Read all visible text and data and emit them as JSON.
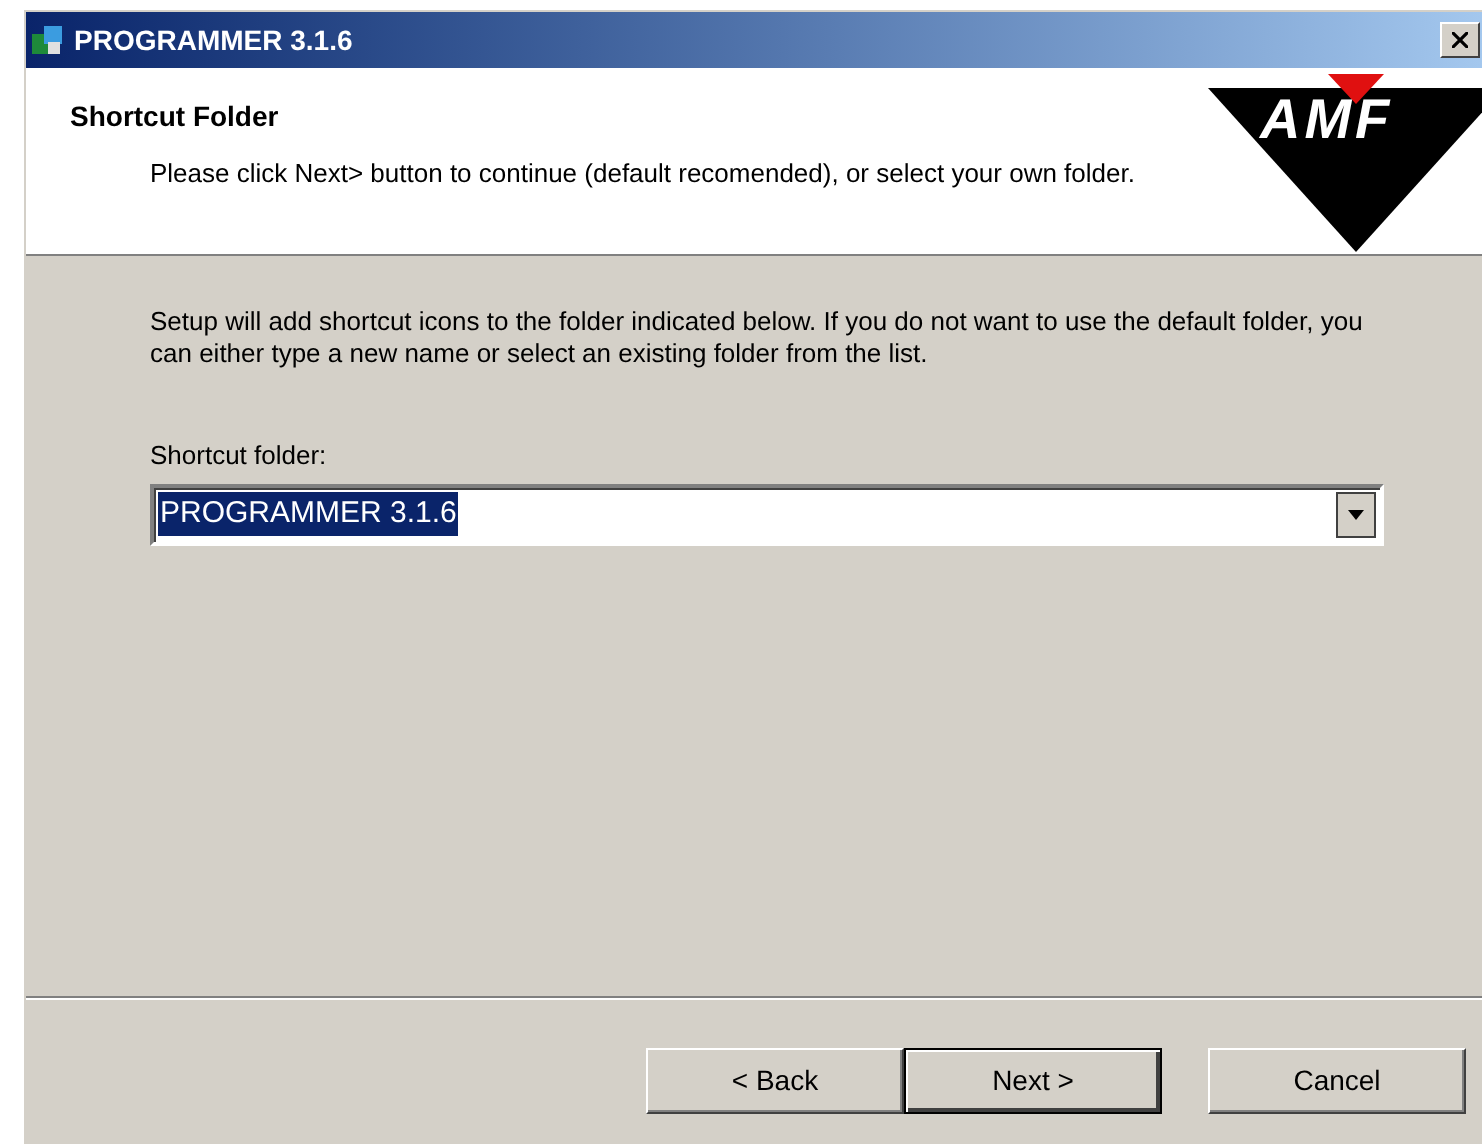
{
  "window": {
    "title": "PROGRAMMER 3.1.6"
  },
  "header": {
    "title": "Shortcut Folder",
    "subtitle": "Please click Next> button to continue (default recomended), or select your own folder.",
    "logo_text": "AMF"
  },
  "body": {
    "description": "Setup will add shortcut icons to the folder indicated below. If you do not want to use the default folder, you can either type a new name or select an existing folder from the list.",
    "field_label": "Shortcut folder:",
    "field_value": "PROGRAMMER 3.1.6",
    "value_selected": true
  },
  "buttons": [
    {
      "label": "< Back",
      "default": false
    },
    {
      "label": "Next >",
      "default": true
    },
    {
      "label": "Cancel",
      "default": false
    }
  ]
}
